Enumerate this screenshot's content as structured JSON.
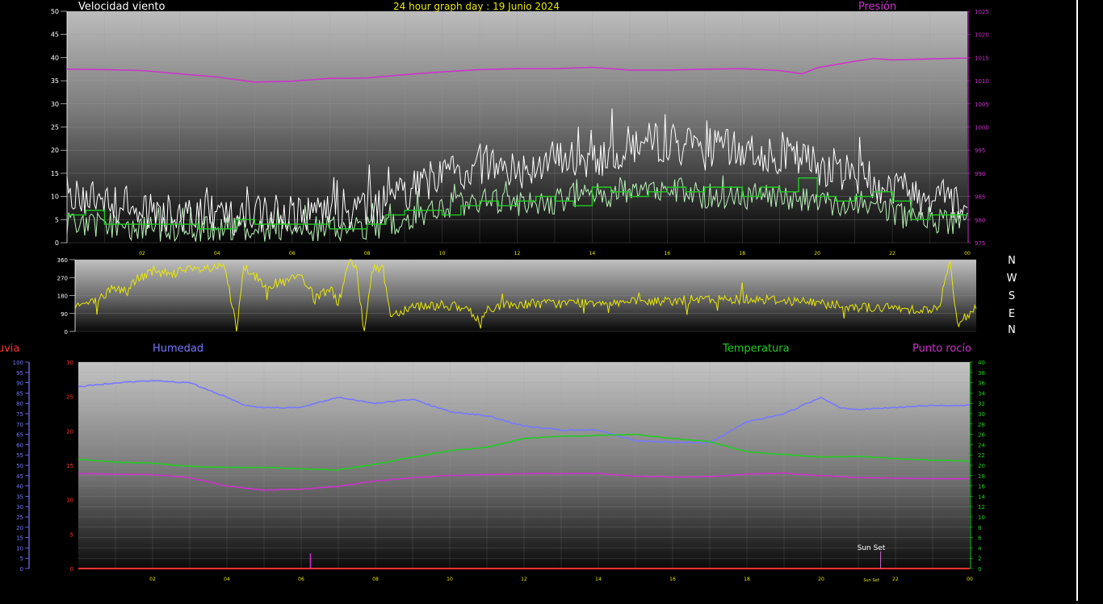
{
  "header": {
    "wind_title": "Velocidad viento",
    "graph_title": "24 hour graph day : 19 Junio 2024",
    "pressure_title": "Presión"
  },
  "labels": {
    "rain": "Lluvia",
    "humidity": "Humedad",
    "temperature": "Temperatura",
    "dew_point": "Punto rocío",
    "sunset": "Sun Set",
    "sunset_axis": "Sun Set"
  },
  "compass": [
    "N",
    "W",
    "S",
    "E",
    "N"
  ],
  "x_ticks": [
    "02",
    "04",
    "06",
    "08",
    "10",
    "12",
    "14",
    "16",
    "18",
    "20",
    "22",
    "00"
  ],
  "colors": {
    "wind_gust": "#ffffff",
    "wind_speed": "#b8f0b8",
    "wind_avg": "#22cc22",
    "pressure": "#cc33cc",
    "direction": "#e8e800",
    "humidity": "#7777ff",
    "temperature": "#22cc22",
    "dew_point": "#cc33cc",
    "rain": "#ff3333",
    "title": "#e8e800"
  },
  "chart_data": [
    {
      "type": "line",
      "name": "wind_pressure",
      "x_range": [
        0,
        24
      ],
      "left_axis": {
        "ticks": [
          "0",
          "5",
          "10",
          "15",
          "20",
          "25",
          "30",
          "35",
          "40",
          "45",
          "50"
        ],
        "range": [
          0,
          50
        ]
      },
      "right_axis": {
        "ticks": [
          "975",
          "980",
          "985",
          "990",
          "995",
          "1000",
          "1005",
          "1010",
          "1015",
          "1020",
          "1025"
        ],
        "range": [
          975,
          1025
        ]
      },
      "series": [
        {
          "key": "gust",
          "envelope": [
            [
              0,
              9
            ],
            [
              1,
              9
            ],
            [
              2,
              7
            ],
            [
              3,
              6
            ],
            [
              4,
              6
            ],
            [
              5,
              6
            ],
            [
              6,
              6
            ],
            [
              7,
              6
            ],
            [
              8,
              7
            ],
            [
              9,
              10
            ],
            [
              10,
              15
            ],
            [
              11,
              17
            ],
            [
              12,
              16
            ],
            [
              13,
              18
            ],
            [
              14,
              18
            ],
            [
              15,
              21
            ],
            [
              16,
              22
            ],
            [
              17,
              20
            ],
            [
              18,
              20
            ],
            [
              19,
              19
            ],
            [
              20,
              17
            ],
            [
              21,
              15
            ],
            [
              22,
              12
            ],
            [
              23,
              10
            ],
            [
              24,
              9
            ]
          ]
        },
        {
          "key": "speed",
          "envelope": [
            [
              0,
              4
            ],
            [
              1,
              4
            ],
            [
              2,
              3
            ],
            [
              3,
              3
            ],
            [
              4,
              3
            ],
            [
              5,
              3
            ],
            [
              6,
              3
            ],
            [
              7,
              3
            ],
            [
              8,
              3
            ],
            [
              9,
              5
            ],
            [
              10,
              8
            ],
            [
              11,
              9
            ],
            [
              12,
              8
            ],
            [
              13,
              9
            ],
            [
              14,
              10
            ],
            [
              15,
              11
            ],
            [
              16,
              12
            ],
            [
              17,
              10
            ],
            [
              18,
              10
            ],
            [
              19,
              10
            ],
            [
              20,
              9
            ],
            [
              21,
              8
            ],
            [
              22,
              6
            ],
            [
              23,
              5
            ],
            [
              24,
              4
            ]
          ]
        },
        {
          "key": "avg",
          "steps": [
            [
              0,
              6
            ],
            [
              0.5,
              7
            ],
            [
              1,
              4
            ],
            [
              2,
              4
            ],
            [
              3,
              4
            ],
            [
              3.5,
              3
            ],
            [
              4,
              3
            ],
            [
              4.5,
              5
            ],
            [
              5,
              4
            ],
            [
              6,
              4
            ],
            [
              7,
              3
            ],
            [
              8,
              4
            ],
            [
              8.5,
              6
            ],
            [
              9,
              7
            ],
            [
              10,
              6
            ],
            [
              10.5,
              8
            ],
            [
              11,
              9
            ],
            [
              11.5,
              8
            ],
            [
              12,
              9
            ],
            [
              12.5,
              10
            ],
            [
              13,
              9
            ],
            [
              13.5,
              8
            ],
            [
              14,
              12
            ],
            [
              14.5,
              11
            ],
            [
              15,
              10
            ],
            [
              15.5,
              11
            ],
            [
              16,
              12
            ],
            [
              16.5,
              11
            ],
            [
              17,
              12
            ],
            [
              17.5,
              12
            ],
            [
              18,
              10
            ],
            [
              18.5,
              12
            ],
            [
              19,
              11
            ],
            [
              19.5,
              14
            ],
            [
              20,
              10
            ],
            [
              20.5,
              9
            ],
            [
              21,
              10
            ],
            [
              21.5,
              11
            ],
            [
              22,
              9
            ],
            [
              22.5,
              5
            ],
            [
              23,
              6
            ],
            [
              24,
              6
            ]
          ]
        },
        {
          "key": "pressure",
          "points": [
            [
              0,
              1012.5
            ],
            [
              1,
              1012.4
            ],
            [
              2,
              1012.2
            ],
            [
              3,
              1011.5
            ],
            [
              4,
              1010.8
            ],
            [
              5,
              1009.7
            ],
            [
              6,
              1009.9
            ],
            [
              7,
              1010.5
            ],
            [
              8,
              1010.6
            ],
            [
              9,
              1011.3
            ],
            [
              10,
              1011.9
            ],
            [
              11,
              1012.4
            ],
            [
              12,
              1012.6
            ],
            [
              13,
              1012.6
            ],
            [
              14,
              1012.9
            ],
            [
              15,
              1012.3
            ],
            [
              16,
              1012.3
            ],
            [
              17,
              1012.5
            ],
            [
              18,
              1012.6
            ],
            [
              19,
              1012.2
            ],
            [
              19.6,
              1011.5
            ],
            [
              20,
              1012.8
            ],
            [
              21,
              1014.2
            ],
            [
              21.5,
              1014.8
            ],
            [
              22,
              1014.5
            ],
            [
              23,
              1014.7
            ],
            [
              24,
              1014.9
            ]
          ]
        }
      ]
    },
    {
      "type": "line",
      "name": "wind_direction",
      "x_range": [
        0,
        24
      ],
      "y_axis": {
        "ticks": [
          "0",
          "90",
          "180",
          "270",
          "360"
        ],
        "range": [
          0,
          360
        ]
      },
      "series": [
        {
          "key": "direction",
          "points": [
            [
              0,
              130
            ],
            [
              0.6,
              150
            ],
            [
              1,
              220
            ],
            [
              1.4,
              200
            ],
            [
              1.6,
              260
            ],
            [
              2,
              290
            ],
            [
              3,
              305
            ],
            [
              4,
              320
            ],
            [
              4.3,
              0
            ],
            [
              4.5,
              330
            ],
            [
              5,
              240
            ],
            [
              5.5,
              240
            ],
            [
              6,
              280
            ],
            [
              6.4,
              160
            ],
            [
              6.8,
              220
            ],
            [
              7,
              130
            ],
            [
              7.3,
              360
            ],
            [
              7.5,
              300
            ],
            [
              7.7,
              0
            ],
            [
              7.9,
              310
            ],
            [
              8.2,
              320
            ],
            [
              8.4,
              80
            ],
            [
              9,
              130
            ],
            [
              10,
              130
            ],
            [
              10.5,
              100
            ],
            [
              10.8,
              40
            ],
            [
              11,
              120
            ],
            [
              12,
              140
            ],
            [
              13,
              140
            ],
            [
              14,
              150
            ],
            [
              15,
              145
            ],
            [
              16,
              155
            ],
            [
              17,
              160
            ],
            [
              18,
              165
            ],
            [
              19,
              155
            ],
            [
              20,
              140
            ],
            [
              21,
              120
            ],
            [
              22,
              115
            ],
            [
              23,
              110
            ],
            [
              23.3,
              350
            ],
            [
              23.5,
              20
            ],
            [
              24,
              130
            ]
          ]
        }
      ]
    },
    {
      "type": "line",
      "name": "humidity_temperature",
      "x_range": [
        0,
        24
      ],
      "left_axis_humidity": {
        "ticks": [
          "0",
          "5",
          "10",
          "15",
          "20",
          "25",
          "30",
          "35",
          "40",
          "45",
          "50",
          "55",
          "60",
          "65",
          "70",
          "75",
          "80",
          "85",
          "90",
          "95",
          "100"
        ],
        "range": [
          0,
          100
        ]
      },
      "inner_axis_rain": {
        "ticks": [
          "0",
          "5",
          "10",
          "15",
          "20",
          "25",
          "30"
        ],
        "range": [
          0,
          30
        ]
      },
      "right_axis_temperature": {
        "ticks": [
          "0",
          "2",
          "4",
          "6",
          "8",
          "10",
          "12",
          "14",
          "16",
          "18",
          "20",
          "22",
          "24",
          "26",
          "28",
          "30",
          "32",
          "34",
          "36",
          "38",
          "40"
        ],
        "range": [
          0,
          40
        ]
      },
      "series": [
        {
          "key": "humidity",
          "axis": "humidity",
          "points": [
            [
              0,
              88
            ],
            [
              1,
              90
            ],
            [
              2,
              91
            ],
            [
              3,
              90
            ],
            [
              4,
              83
            ],
            [
              4.5,
              79
            ],
            [
              5,
              78
            ],
            [
              6,
              78
            ],
            [
              7,
              83
            ],
            [
              8,
              80
            ],
            [
              9,
              82
            ],
            [
              10,
              76
            ],
            [
              11,
              74
            ],
            [
              12,
              69
            ],
            [
              13,
              67
            ],
            [
              14,
              67
            ],
            [
              15,
              62
            ],
            [
              16,
              61
            ],
            [
              17,
              61
            ],
            [
              18,
              71
            ],
            [
              19,
              75
            ],
            [
              20,
              83
            ],
            [
              20.5,
              78
            ],
            [
              21,
              77
            ],
            [
              22,
              78
            ],
            [
              23,
              79
            ],
            [
              24,
              79
            ]
          ]
        },
        {
          "key": "temperature",
          "axis": "temperature",
          "points": [
            [
              0,
              21.2
            ],
            [
              1,
              20.6
            ],
            [
              2,
              20.4
            ],
            [
              3,
              19.8
            ],
            [
              4,
              19.6
            ],
            [
              5,
              19.6
            ],
            [
              6,
              19.3
            ],
            [
              7,
              19.1
            ],
            [
              8,
              20.2
            ],
            [
              9,
              21.6
            ],
            [
              10,
              22.8
            ],
            [
              11,
              23.5
            ],
            [
              12,
              25.2
            ],
            [
              13,
              25.6
            ],
            [
              14,
              25.8
            ],
            [
              15,
              26.0
            ],
            [
              16,
              25.2
            ],
            [
              17,
              24.6
            ],
            [
              18,
              22.6
            ],
            [
              19,
              22.1
            ],
            [
              20,
              21.6
            ],
            [
              21,
              21.7
            ],
            [
              22,
              21.3
            ],
            [
              23,
              21.0
            ],
            [
              24,
              20.8
            ]
          ]
        },
        {
          "key": "dew_point",
          "axis": "temperature",
          "points": [
            [
              0,
              18.4
            ],
            [
              1,
              18.3
            ],
            [
              2,
              18.2
            ],
            [
              3,
              17.6
            ],
            [
              4,
              16.0
            ],
            [
              5,
              15.2
            ],
            [
              6,
              15.4
            ],
            [
              7,
              15.9
            ],
            [
              8,
              17.0
            ],
            [
              9,
              17.6
            ],
            [
              10,
              18.0
            ],
            [
              11,
              18.2
            ],
            [
              12,
              18.4
            ],
            [
              13,
              18.4
            ],
            [
              14,
              18.4
            ],
            [
              15,
              17.9
            ],
            [
              16,
              17.7
            ],
            [
              17,
              17.8
            ],
            [
              18,
              18.3
            ],
            [
              19,
              18.5
            ],
            [
              20,
              18.0
            ],
            [
              21,
              17.6
            ],
            [
              22,
              17.5
            ],
            [
              23,
              17.4
            ],
            [
              24,
              17.4
            ]
          ]
        },
        {
          "key": "rain",
          "axis": "rain",
          "points": [
            [
              0,
              0
            ],
            [
              24,
              0
            ]
          ]
        }
      ],
      "markers": [
        {
          "key": "rain_event",
          "x": 6.25,
          "value": 2.2
        },
        {
          "key": "sunset",
          "x": 21.6,
          "value": 2.5
        }
      ]
    }
  ]
}
